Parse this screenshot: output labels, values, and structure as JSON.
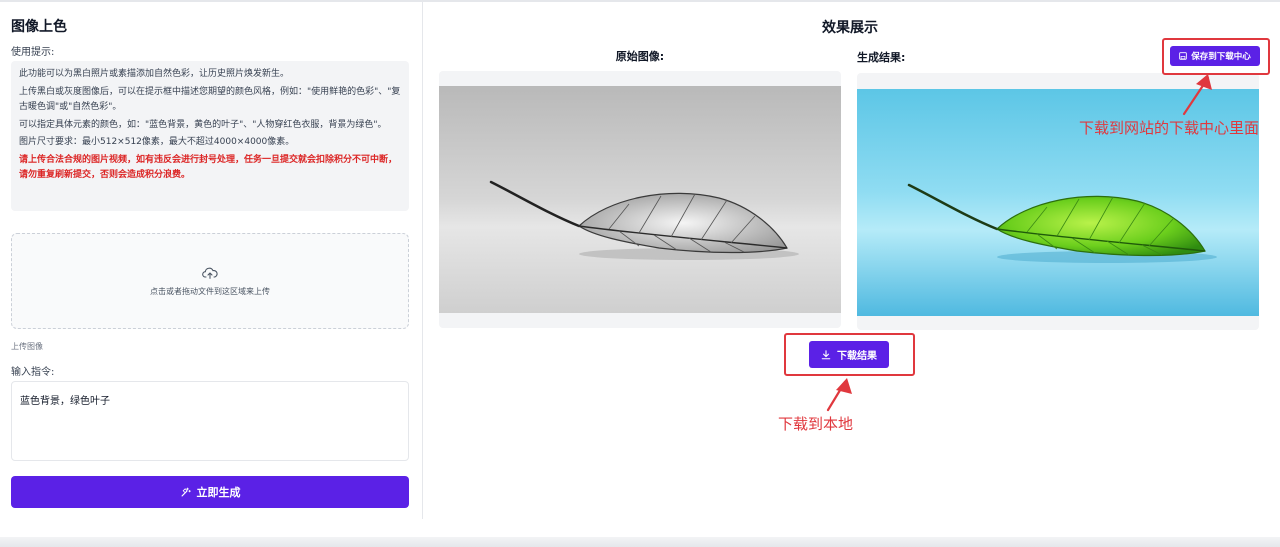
{
  "left": {
    "title": "图像上色",
    "tips_label": "使用提示:",
    "tips": [
      "此功能可以为黑白照片或素描添加自然色彩，让历史照片焕发新生。",
      "上传黑白或灰度图像后，可以在提示框中描述您期望的颜色风格，例如：\"使用鲜艳的色彩\"、\"复古暖色调\"或\"自然色彩\"。",
      "可以指定具体元素的颜色，如：\"蓝色背景，黄色的叶子\"、\"人物穿红色衣服，背景为绿色\"。",
      "图片尺寸要求：最小512×512像素，最大不超过4000×4000像素。"
    ],
    "warning": "请上传合法合规的图片视频，如有违反会进行封号处理，任务一旦提交就会扣除积分不可中断，请勿重复刷新提交，否则会造成积分浪费。",
    "upload_text": "点击或者拖动文件到这区域来上传",
    "upload_label": "上传图像",
    "prompt_label": "输入指令:",
    "prompt_value": "蓝色背景，绿色叶子",
    "generate_button": "立即生成"
  },
  "right": {
    "title": "效果展示",
    "original_label": "原始图像:",
    "result_label": "生成结果:",
    "save_button": "保存到下载中心",
    "download_button": "下载结果"
  },
  "annotations": {
    "save_note": "下载到网站的下载中心里面",
    "download_note": "下载到本地",
    "color": "#e0383e"
  },
  "colors": {
    "accent": "#5b21e6",
    "warning": "#dc2626"
  },
  "icons": [
    "cloud-upload-icon",
    "magic-wand-icon",
    "save-icon",
    "download-icon"
  ]
}
